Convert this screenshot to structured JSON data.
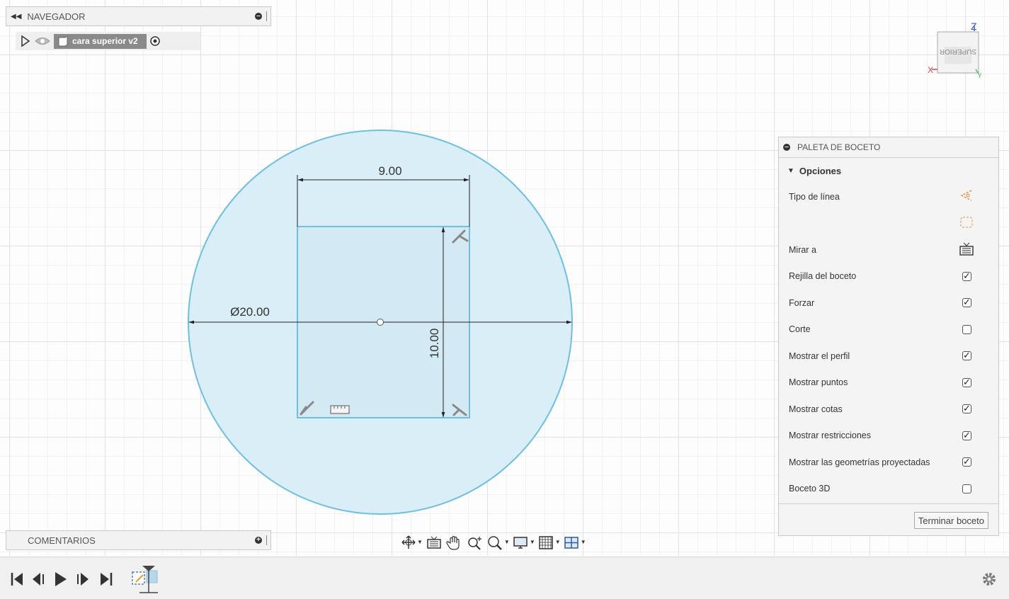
{
  "navigator": {
    "title": "NAVEGADOR",
    "component": "cara superior v2"
  },
  "viewcube": {
    "face": "SUPERIOR",
    "axis_x": "X",
    "axis_y": "Y",
    "axis_z": "Z"
  },
  "sketch": {
    "dim_width": "9.00",
    "dim_height": "10.00",
    "dim_diameter": "Ø20.00"
  },
  "palette": {
    "title": "PALETA DE BOCETO",
    "section": "Opciones",
    "rows": [
      {
        "label": "Tipo de línea",
        "control": "linetype-icon"
      },
      {
        "label": "",
        "control": "construction-icon"
      },
      {
        "label": "Mirar a",
        "control": "look-at-icon"
      },
      {
        "label": "Rejilla del boceto",
        "control": "checkbox",
        "checked": true
      },
      {
        "label": "Forzar",
        "control": "checkbox",
        "checked": true
      },
      {
        "label": "Corte",
        "control": "checkbox",
        "checked": false
      },
      {
        "label": "Mostrar el perfil",
        "control": "checkbox",
        "checked": true
      },
      {
        "label": "Mostrar puntos",
        "control": "checkbox",
        "checked": true
      },
      {
        "label": "Mostrar cotas",
        "control": "checkbox",
        "checked": true
      },
      {
        "label": "Mostrar restricciones",
        "control": "checkbox",
        "checked": true
      },
      {
        "label": "Mostrar las geometrías proyectadas",
        "control": "checkbox",
        "checked": true
      },
      {
        "label": "Boceto 3D",
        "control": "checkbox",
        "checked": false
      }
    ],
    "finish_label": "Terminar boceto"
  },
  "comments": {
    "title": "COMENTARIOS"
  },
  "colors": {
    "sketch_line": "#6fbfe0",
    "profile_fill": "#d9eef7",
    "dimension": "#222222",
    "constraint": "#888888"
  }
}
